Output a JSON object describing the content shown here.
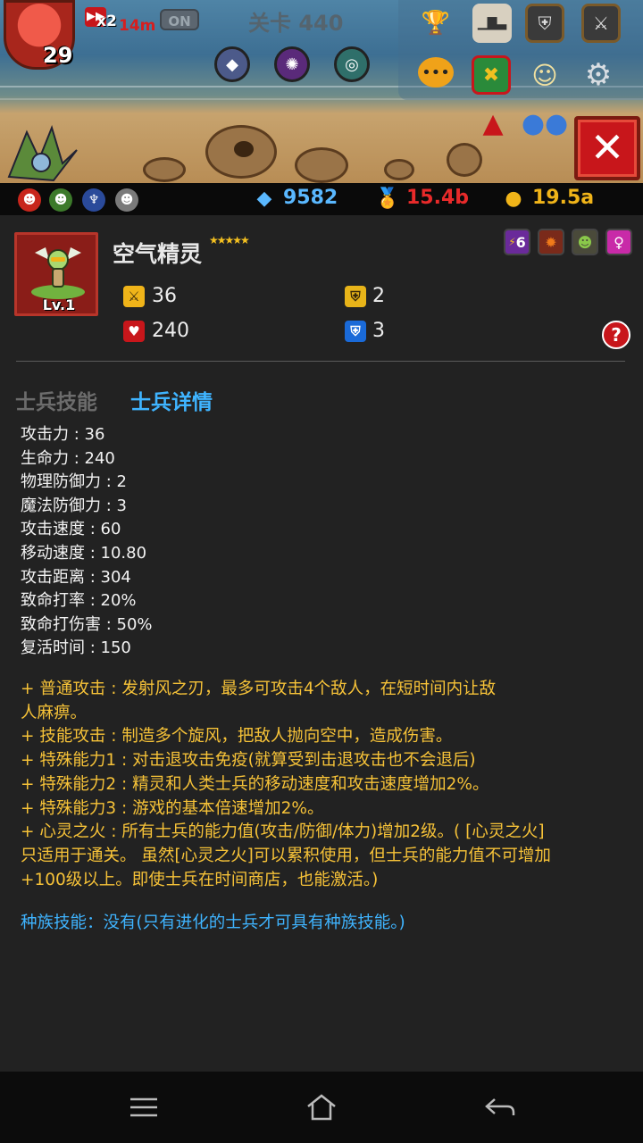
{
  "hud": {
    "player_level": "29",
    "speed_multiplier": "x2",
    "timer": "14m",
    "auto_toggle": "ON",
    "stage_title": "关卡 440"
  },
  "resources": {
    "diamonds": "9582",
    "medals": "15.4b",
    "gold": "19.5a"
  },
  "close_label": "✕",
  "unit": {
    "name": "空气精灵",
    "stars": "★★★★★",
    "level_label": "Lv.1",
    "attack": "36",
    "health": "240",
    "physical_defense": "2",
    "magic_defense": "3",
    "trait_count": "6"
  },
  "help_label": "?",
  "tabs": {
    "skills": "士兵技能",
    "details": "士兵详情"
  },
  "stats": [
    "攻击力 : 36",
    "生命力 : 240",
    "物理防御力 : 2",
    "魔法防御力 : 3",
    "攻击速度 : 60",
    "移动速度 : 10.80",
    "攻击距离 : 304",
    "致命打率 : 20%",
    "致命打伤害 : 50%",
    "复活时间 : 150"
  ],
  "descriptions": [
    "+ 普通攻击 : 发射风之刃，最多可攻击4个敌人，在短时间内让敌",
    "人麻痹。",
    "+ 技能攻击 : 制造多个旋风，把敌人抛向空中，造成伤害。",
    "+ 特殊能力1 : 对击退攻击免疫(就算受到击退攻击也不会退后)",
    "+ 特殊能力2 : 精灵和人类士兵的移动速度和攻击速度增加2%。",
    "+ 特殊能力3 : 游戏的基本倍速增加2%。",
    "+ 心灵之火 : 所有士兵的能力值(攻击/防御/体力)增加2级。( [心灵之火]",
    "只适用于通关。 虽然[心灵之火]可以累积使用，但士兵的能力值不可增加",
    "+100级以上。即使士兵在时间商店，也能激活。)"
  ],
  "race_skill": "种族技能：没有(只有进化的士兵才可具有种族技能。)",
  "icons": {
    "menu": "menu-icon",
    "home": "home-icon",
    "back": "back-icon"
  }
}
